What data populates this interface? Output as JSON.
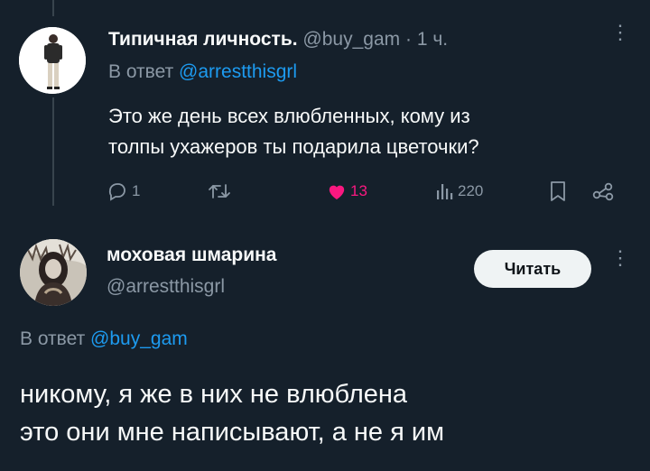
{
  "tweet1": {
    "author_name": "Типичная личность.",
    "author_handle": "@buy_gam",
    "separator": "·",
    "time": "1 ч.",
    "reply_prefix": "В ответ",
    "reply_to": "@arrestthisgrl",
    "text_line1": "Это же день всех влюбленных, кому из",
    "text_line2": "толпы ухажеров ты подарила цветочки?",
    "replies": "1",
    "likes": "13",
    "views": "220",
    "liked": true
  },
  "tweet2": {
    "author_name": "моховая шмарина",
    "author_handle": "@arrestthisgrl",
    "follow_label": "Читать",
    "reply_prefix": "В ответ",
    "reply_to": "@buy_gam",
    "text_line1": "никому, я же в них не влюблена",
    "text_line2": "это они мне написывают, а не я им"
  },
  "icons": [
    "reply-icon",
    "retweet-icon",
    "heart-icon",
    "views-icon",
    "bookmark-icon",
    "share-icon",
    "more-icon"
  ],
  "colors": {
    "background": "#15202b",
    "muted": "#8b98a5",
    "link": "#1d9bf0",
    "like": "#f91880"
  }
}
